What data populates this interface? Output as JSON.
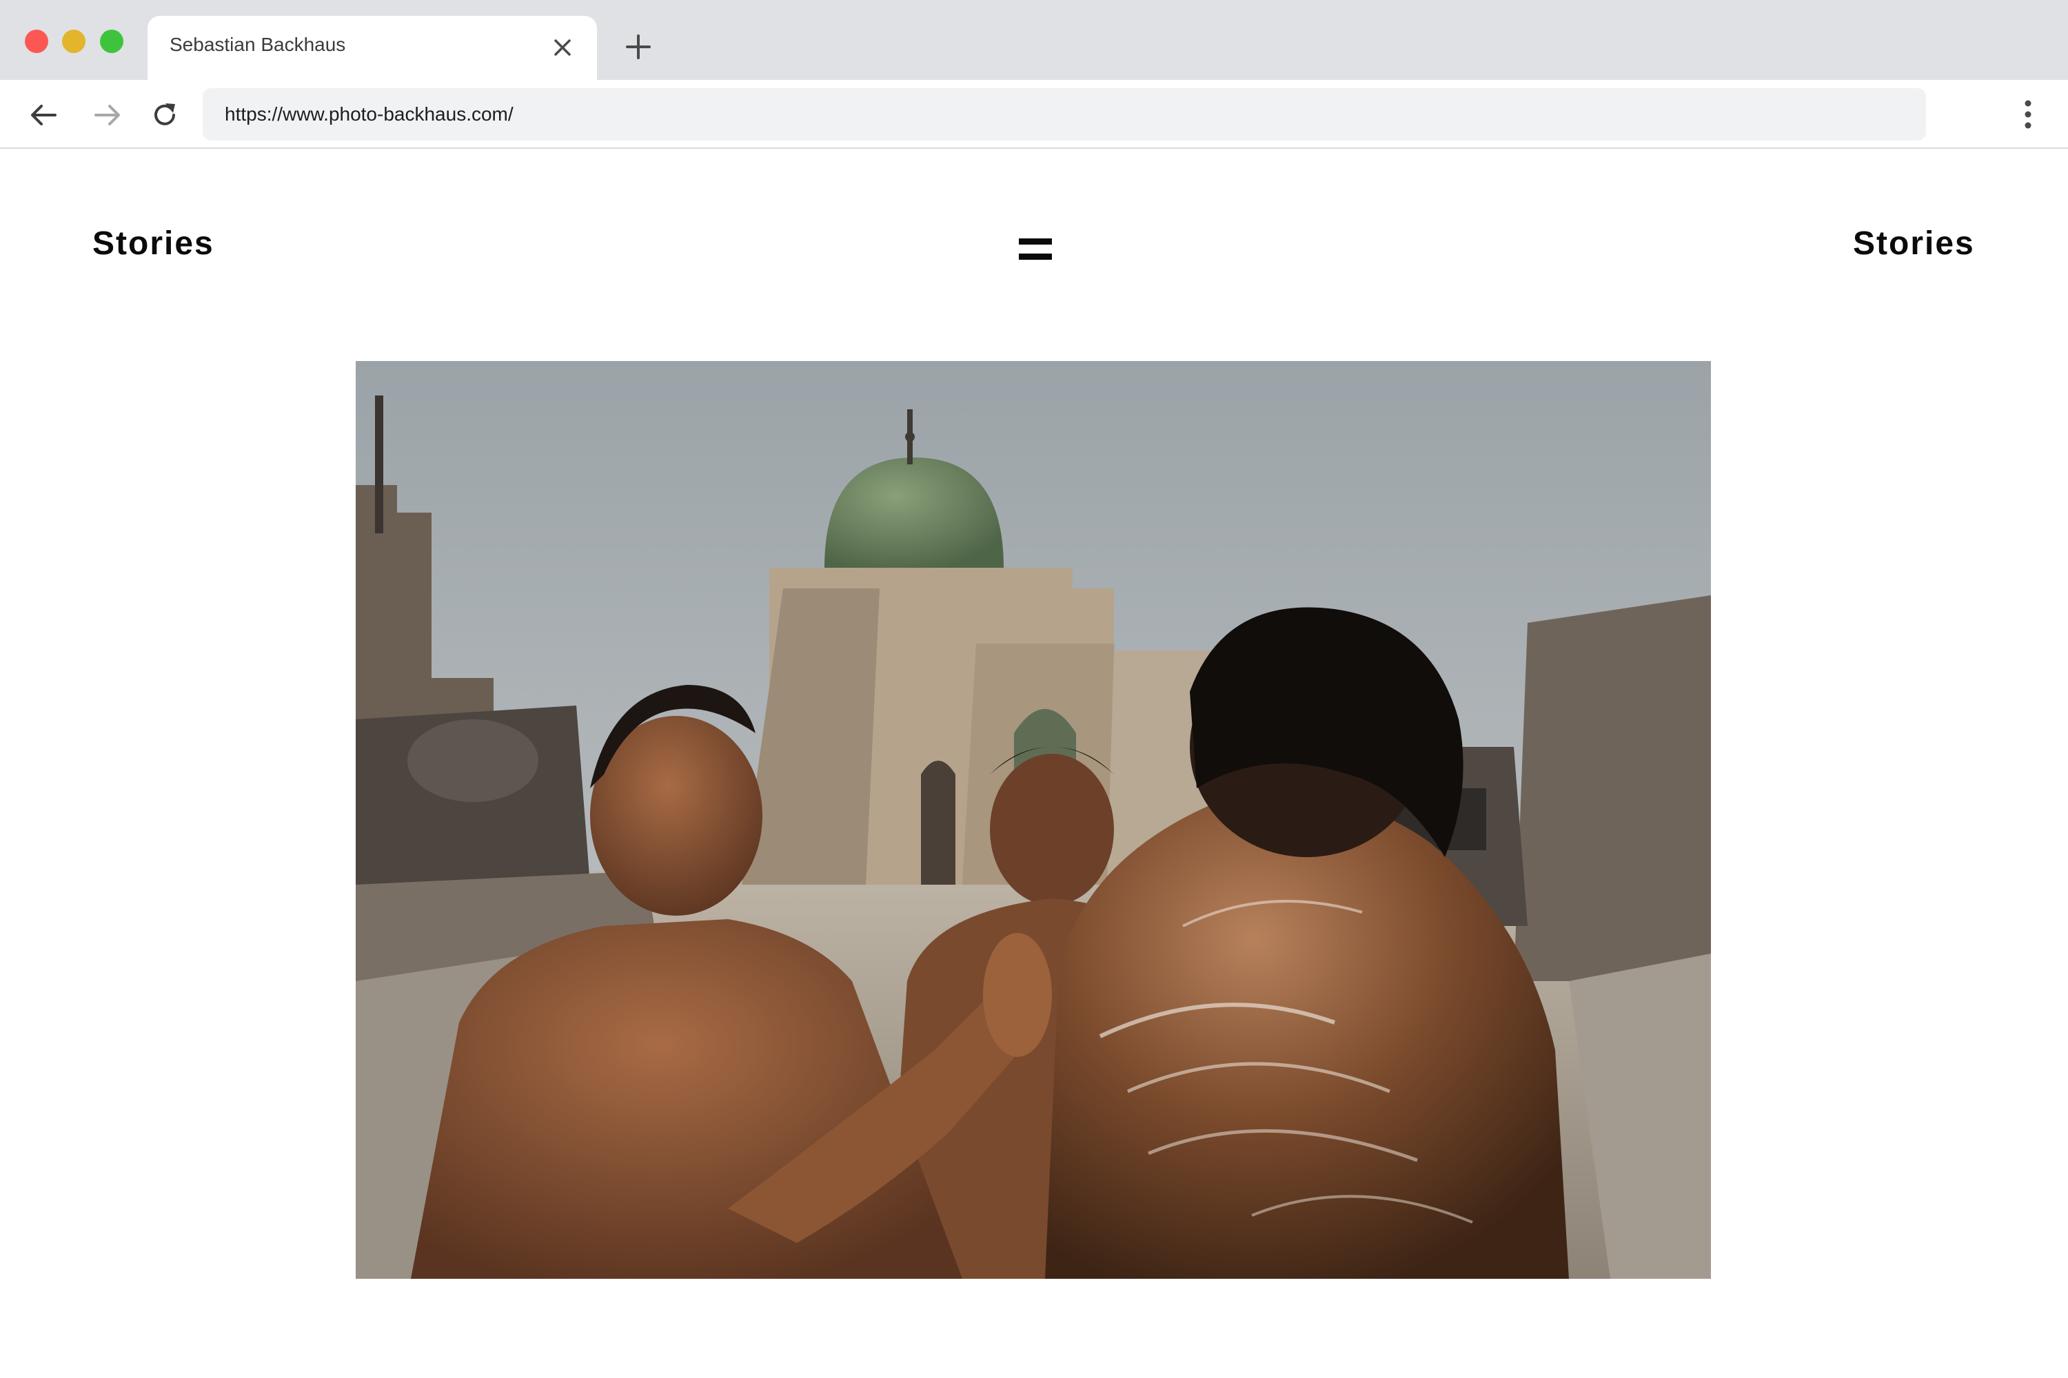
{
  "browser": {
    "tab_title": "Sebastian Backhaus",
    "url": "https://www.photo-backhaus.com/",
    "icons": {
      "close": "close-icon",
      "new_tab": "plus-icon",
      "back": "arrow-left-icon",
      "forward": "arrow-right-icon",
      "reload": "reload-icon",
      "menu": "kebab-menu-icon"
    }
  },
  "site": {
    "nav_left": "Stories",
    "nav_right": "Stories",
    "menu_icon": "hamburger-icon"
  },
  "colors": {
    "tabstrip_bg": "#dfe1e5",
    "close_red": "#fd5753",
    "minimize_yellow": "#e2b52a",
    "zoom_green": "#40c33c",
    "text_dark": "#0b0b0b"
  }
}
